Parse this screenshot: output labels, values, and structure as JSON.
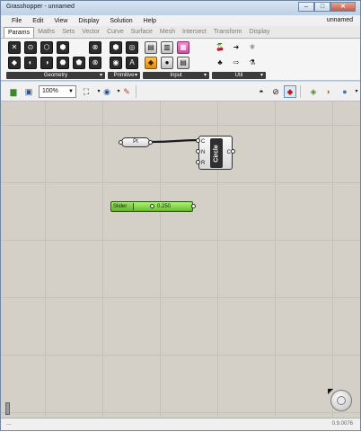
{
  "window": {
    "title": "Grasshopper - unnamed",
    "controls": [
      "–",
      "□",
      "✕"
    ]
  },
  "menu": {
    "items": [
      "File",
      "Edit",
      "View",
      "Display",
      "Solution",
      "Help"
    ],
    "doc_name": "unnamed"
  },
  "tabs": [
    "Params",
    "Maths",
    "Sets",
    "Vector",
    "Curve",
    "Surface",
    "Mesh",
    "Intersect",
    "Transform",
    "Display"
  ],
  "ribbon": {
    "panels": [
      {
        "label": "Geometry",
        "icons": [
          [
            "✕",
            "⊙",
            "⬡",
            "⬢",
            "⊗"
          ],
          [
            "◆",
            "◐",
            "◑",
            "⬣",
            "⬟",
            "⊗"
          ]
        ]
      },
      {
        "label": "Primitive",
        "icons": [
          [
            "⬢",
            "◎"
          ],
          [
            "◉",
            "A"
          ]
        ]
      },
      {
        "label": "Input",
        "icons": [
          [
            "▤",
            "▥",
            "▦"
          ],
          [
            "◆",
            "●",
            "▤"
          ]
        ]
      },
      {
        "label": "Util",
        "icons": [
          [
            "🍒",
            "➜",
            "⚛"
          ],
          [
            "♣",
            "⇨",
            "⚗"
          ]
        ]
      }
    ]
  },
  "toolbar": {
    "zoom": "100%"
  },
  "canvas": {
    "point_param": {
      "label": "Pt"
    },
    "circle": {
      "name": "Circle",
      "inputs": [
        "C",
        "N",
        "R"
      ],
      "output": "C"
    },
    "slider": {
      "label": "Slider",
      "value": "0.250"
    }
  },
  "status": {
    "left": "...",
    "version": "0.9.0076"
  },
  "colors": {
    "canvas": "#d4d0c8",
    "slider_green": "#7bd03f",
    "component": "#2f2f2f"
  }
}
